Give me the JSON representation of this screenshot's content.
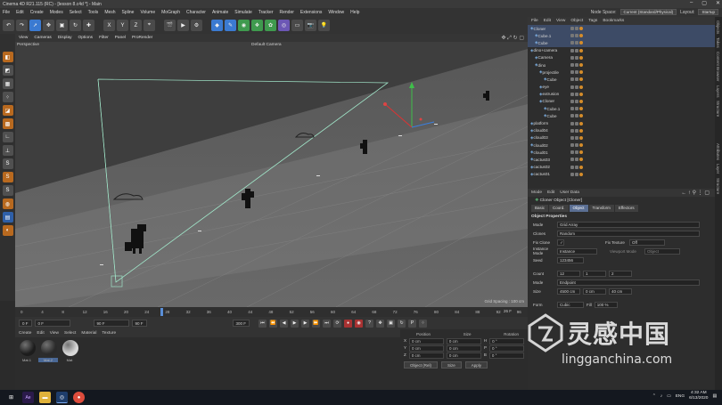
{
  "window": {
    "title": "Cinema 4D R21.115 (RC) - [lesson 8.c4d *] - Main",
    "controls": [
      "–",
      "▢",
      "✕"
    ]
  },
  "menu": {
    "items": [
      "File",
      "Edit",
      "Create",
      "Modes",
      "Select",
      "Tools",
      "Mesh",
      "Spline",
      "Volume",
      "MoGraph",
      "Character",
      "Animate",
      "Simulate",
      "Tracker",
      "Render",
      "Extensions",
      "Window",
      "Help"
    ],
    "node_space_label": "Node Space:",
    "node_space_value": "Current (Standard/Physical)",
    "layout_label": "Layout:",
    "layout_value": "Startup"
  },
  "toolbar": {
    "axes": [
      "X",
      "Y",
      "Z"
    ]
  },
  "viewport": {
    "menu": [
      "View",
      "Cameras",
      "Display",
      "Options",
      "Filter",
      "Panel",
      "ProRender"
    ],
    "label": "Perspective",
    "camera": "Default Camera",
    "grid_spacing": "Grid Spacing : 100 cm"
  },
  "timeline": {
    "ticks": [
      "0",
      "4",
      "8",
      "12",
      "16",
      "20",
      "24",
      "28",
      "32",
      "36",
      "40",
      "44",
      "48",
      "52",
      "56",
      "60",
      "64",
      "68",
      "72",
      "76",
      "80",
      "84",
      "88",
      "92",
      "96"
    ],
    "current_frame_marker": "25 F",
    "end_marker": "26 F"
  },
  "transport": {
    "start": "0 F",
    "min": "0 F",
    "max": "90 F",
    "end": "90 F",
    "fps": "300 F"
  },
  "materials": {
    "menu": [
      "Create",
      "Edit",
      "View",
      "Select",
      "Material",
      "Texture"
    ],
    "items": [
      {
        "label": "Mat.1",
        "color": "#1c1c1c"
      },
      {
        "label": "Mat.2",
        "color": "#2a2a2a"
      },
      {
        "label": "Mat",
        "color": "#d9d9d9"
      }
    ]
  },
  "coordinates": {
    "headers": [
      "Position",
      "Size",
      "Rotation"
    ],
    "rows": [
      {
        "axis": "X",
        "pos": "0 cm",
        "size": "0 cm",
        "rot_axis": "H",
        "rot": "0 °"
      },
      {
        "axis": "Y",
        "pos": "0 cm",
        "size": "0 cm",
        "rot_axis": "P",
        "rot": "0 °"
      },
      {
        "axis": "Z",
        "pos": "0 cm",
        "size": "0 cm",
        "rot_axis": "B",
        "rot": "0 °"
      }
    ],
    "mode": "Object (Rel)",
    "size_mode": "Size",
    "apply": "Apply"
  },
  "object_manager": {
    "menu": [
      "File",
      "Edit",
      "View",
      "Object",
      "Tags",
      "Bookmarks"
    ],
    "objects": [
      {
        "name": "Cloner",
        "indent": 0,
        "selected": true
      },
      {
        "name": "Cube.1",
        "indent": 1,
        "selected": true
      },
      {
        "name": "Cube",
        "indent": 1,
        "selected": true
      },
      {
        "name": "dino+camera",
        "indent": 0,
        "selected": false
      },
      {
        "name": "Camera",
        "indent": 1,
        "selected": false
      },
      {
        "name": "dino",
        "indent": 1,
        "selected": false
      },
      {
        "name": "projectile",
        "indent": 2,
        "selected": false
      },
      {
        "name": "Cube",
        "indent": 3,
        "selected": false
      },
      {
        "name": "eye",
        "indent": 2,
        "selected": false
      },
      {
        "name": "extrusion",
        "indent": 2,
        "selected": false
      },
      {
        "name": "Cloner",
        "indent": 2,
        "selected": false
      },
      {
        "name": "Cube.1",
        "indent": 3,
        "selected": false
      },
      {
        "name": "Cube",
        "indent": 3,
        "selected": false
      },
      {
        "name": "platform",
        "indent": 0,
        "selected": false
      },
      {
        "name": "cloud04",
        "indent": 0,
        "selected": false
      },
      {
        "name": "cloud03",
        "indent": 0,
        "selected": false
      },
      {
        "name": "cloud02",
        "indent": 0,
        "selected": false
      },
      {
        "name": "cloud01",
        "indent": 0,
        "selected": false
      },
      {
        "name": "cactus03",
        "indent": 0,
        "selected": false
      },
      {
        "name": "cactus02",
        "indent": 0,
        "selected": false
      },
      {
        "name": "cactus01",
        "indent": 0,
        "selected": false
      }
    ]
  },
  "attributes": {
    "menu": [
      "Mode",
      "Edit",
      "User Data"
    ],
    "title": "Cloner Object [Cloner]",
    "tabs": [
      "Basic",
      "Coord.",
      "Object",
      "Transform",
      "Effectors"
    ],
    "active_tab": "Object",
    "section": "Object Properties",
    "mode_label": "Mode",
    "mode_value": "Grid Array",
    "clones_label": "Clones",
    "clones_value": "Random",
    "fix_clone_label": "Fix Clone",
    "fix_texture_label": "Fix Texture",
    "fix_texture_value": "Off",
    "instance_mode_label": "Instance Mode",
    "instance_mode_value": "Instance",
    "viewport_mode_label": "Viewport Mode",
    "viewport_mode_value": "Object",
    "seed_label": "Seed",
    "seed_value": "123456",
    "count_label": "Count",
    "count_values": [
      "12",
      "1",
      "2"
    ],
    "mode2_label": "Mode",
    "mode2_value": "Endpoint",
    "size_label": "Size",
    "size_values": [
      "4500 cm",
      "0 cm",
      "40 cm"
    ],
    "form_label": "Form",
    "form_value": "Cubic",
    "fill_label": "Fill",
    "fill_value": "100 %"
  },
  "right_strip_tabs": [
    "Objects",
    "Takes",
    "Content Browser",
    "Layers",
    "Structure",
    "Attributes",
    "Layer",
    "Structure"
  ],
  "taskbar": {
    "apps": [
      "windows-start",
      "after-effects",
      "file-explorer",
      "cinema4d",
      "chrome"
    ],
    "lang": "ENG",
    "time": "4:32 AM",
    "date": "6/13/2020"
  },
  "watermark": {
    "cn": "灵感中国",
    "en": "lingganchina.com"
  }
}
